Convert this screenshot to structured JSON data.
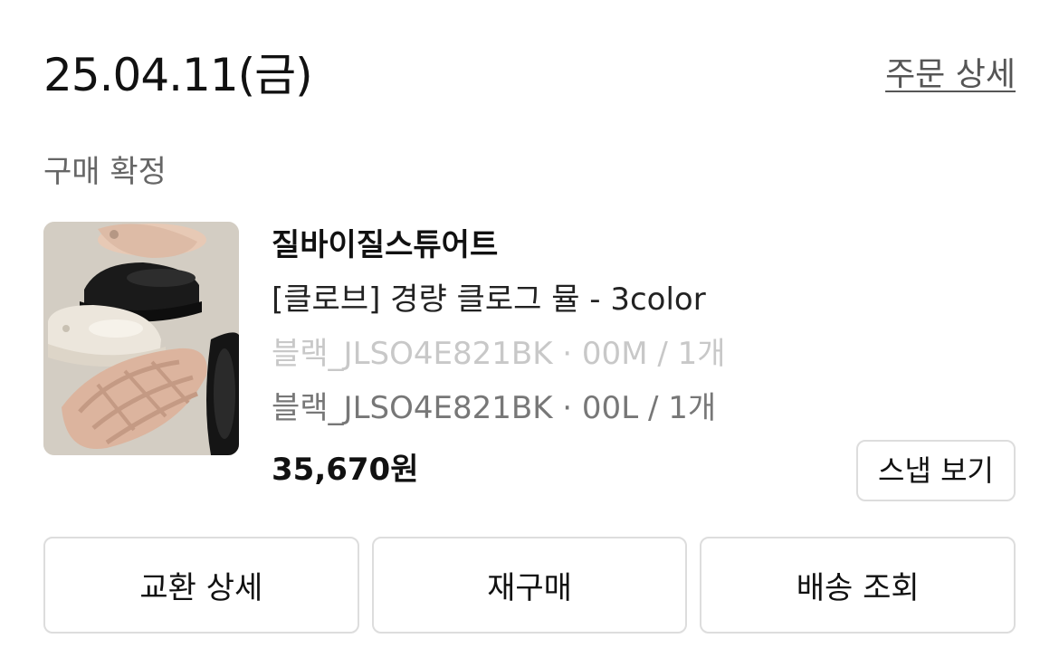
{
  "order": {
    "date": "25.04.11(금)",
    "detail_link": "주문 상세",
    "status": "구매 확정"
  },
  "product": {
    "image": "product-photo-clogs",
    "brand": "질바이질스튜어트",
    "name": "[클로브] 경량 클로그 뮬 - 3color",
    "options": [
      "블랙_JLSO4E821BK · 00M / 1개",
      "블랙_JLSO4E821BK · 00L / 1개"
    ],
    "price": "35,670원",
    "snap_button": "스냅 보기"
  },
  "actions": [
    {
      "label": "교환 상세"
    },
    {
      "label": "재구매"
    },
    {
      "label": "배송 조회"
    }
  ],
  "colors": {
    "border": "#dddddd",
    "muted_text": "#777777",
    "disabled_text": "#c8c8c8"
  }
}
